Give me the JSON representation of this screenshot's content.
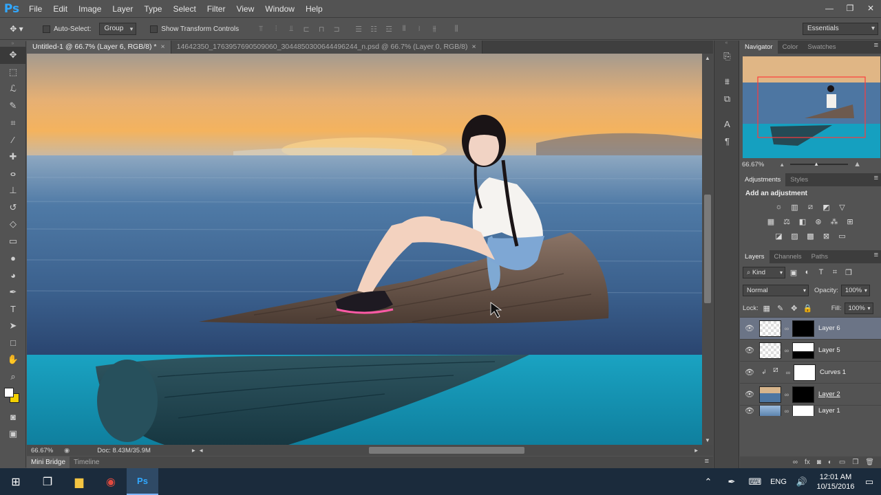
{
  "app": {
    "logo": "Ps"
  },
  "menu": [
    "File",
    "Edit",
    "Image",
    "Layer",
    "Type",
    "Select",
    "Filter",
    "View",
    "Window",
    "Help"
  ],
  "window_controls": {
    "minimize": "—",
    "restore": "❐",
    "close": "✕"
  },
  "options": {
    "auto_select_label": "Auto-Select:",
    "auto_select_mode": "Group",
    "transform_label": "Show Transform Controls",
    "workspace": "Essentials"
  },
  "tabs": [
    {
      "label": "Untitled-1 @ 66.7% (Layer 6, RGB/8) *",
      "close": "×",
      "active": true
    },
    {
      "label": "14642350_1763957690509060_3044850300644496244_n.psd @ 66.7% (Layer 0, RGB/8)",
      "close": "×",
      "active": false
    }
  ],
  "status": {
    "zoom": "66.67%",
    "doc": "Doc: 8.43M/35.9M"
  },
  "bottom_tabs": [
    "Mini Bridge",
    "Timeline"
  ],
  "colors": {
    "foreground": "#ffffff",
    "background": "#f3d000",
    "accent": "#31a8ff"
  },
  "panels": {
    "top_tabs": [
      "Navigator",
      "Color",
      "Swatches"
    ],
    "navigator_zoom": "66.67%",
    "adjust_tabs": [
      "Adjustments",
      "Styles"
    ],
    "adjust_heading": "Add an adjustment",
    "layer_tabs": [
      "Layers",
      "Channels",
      "Paths"
    ],
    "kind": "Kind",
    "blend_mode": "Normal",
    "opacity_label": "Opacity:",
    "opacity": "100%",
    "lock_label": "Lock:",
    "fill_label": "Fill:",
    "fill": "100%"
  },
  "layers": [
    {
      "name": "Layer 6",
      "selected": true
    },
    {
      "name": "Layer 5",
      "selected": false
    },
    {
      "name": "Curves 1",
      "selected": false
    },
    {
      "name": "Layer 2",
      "selected": false
    },
    {
      "name": "Layer 1",
      "selected": false
    }
  ],
  "taskbar": {
    "lang": "ENG",
    "time": "12:01 AM",
    "date": "10/15/2016"
  }
}
